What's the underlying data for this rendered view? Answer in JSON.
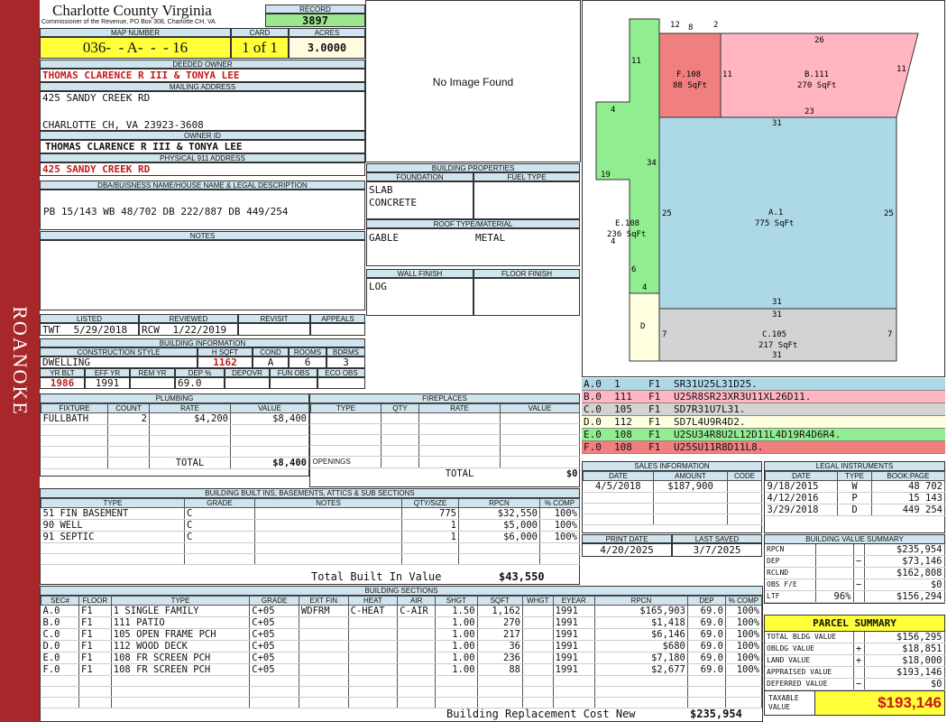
{
  "side_label": "ROANOKE",
  "header": {
    "county": "Charlotte County Virginia",
    "commissioner": "Commissioner of the Revenue, PO Box 308, Charlotte CH, VA",
    "record_label": "RECORD",
    "record": "3897"
  },
  "map": {
    "map_label": "MAP NUMBER",
    "map_number": "036-  - A-  -  - 16",
    "card_label": "CARD",
    "card": "1 of 1",
    "acres_label": "ACRES",
    "acres": "3.0000"
  },
  "owner": {
    "deeded_label": "DEEDED OWNER",
    "deeded": "THOMAS CLARENCE R III & TONYA LEE",
    "mailing_label": "MAILING ADDRESS",
    "mail1": "425 SANDY CREEK RD",
    "mail2": "CHARLOTTE CH, VA 23923-3608",
    "owner_id_label": "OWNER ID",
    "owner_id": "THOMAS CLARENCE R III & TONYA LEE",
    "phys_label": "PHYSICAL 911 ADDRESS",
    "phys": "425 SANDY CREEK RD",
    "dba_label": "DBA/BUISNESS NAME/HOUSE NAME & LEGAL DESCRIPTION",
    "legal": "PB 15/143 WB 48/702 DB 222/887 DB 449/254",
    "notes_label": "NOTES"
  },
  "image_text": "No Image Found",
  "listing": {
    "h": [
      "LISTED",
      "REVIEWED",
      "REVISIT",
      "APPEALS"
    ],
    "listed_by": "TWT",
    "listed": "5/29/2018",
    "reviewed_by": "RCW",
    "reviewed": "1/22/2019"
  },
  "building_info": {
    "title": "BUILDING INFORMATION",
    "h": [
      "CONSTRUCTION STYLE",
      "H SQFT",
      "COND",
      "ROOMS",
      "BDRMS"
    ],
    "style": "DWELLING",
    "hsqft": "1162",
    "cond": "A",
    "rooms": "6",
    "bdrms": "3",
    "h2": [
      "YR BLT",
      "EFF YR",
      "REM YR",
      "DEP %",
      "DEPOVR",
      "FUN OBS",
      "ECO OBS"
    ],
    "yrblt": "1986",
    "effyr": "1991",
    "remyr": "",
    "dep": "69.0"
  },
  "props": {
    "title": "BUILDING PROPERTIES",
    "foundation_label": "FOUNDATION",
    "fuel_label": "FUEL TYPE",
    "foundation1": "SLAB",
    "foundation2": "CONCRETE",
    "roof_label": "ROOF TYPE/MATERIAL",
    "roof1": "GABLE",
    "roof2": "METAL",
    "wall_label": "WALL FINISH",
    "floor_label": "FLOOR FINISH",
    "wall": "LOG"
  },
  "plumbing": {
    "title": "PLUMBING",
    "h": [
      "FIXTURE",
      "COUNT",
      "RATE",
      "VALUE"
    ],
    "rows": [
      [
        "FULLBATH",
        "2",
        "$4,200",
        "$8,400"
      ]
    ],
    "total_label": "TOTAL",
    "total": "$8,400"
  },
  "fireplaces": {
    "title": "FIREPLACES",
    "h": [
      "TYPE",
      "QTY",
      "RATE",
      "VALUE"
    ],
    "openings": "OPENINGS",
    "total_label": "TOTAL",
    "total": "$0"
  },
  "builtins": {
    "title": "BUILDING BUILT INS, BASEMENTS, ATTICS & SUB SECTIONS",
    "h": [
      "TYPE",
      "GRADE",
      "NOTES",
      "QTY/SIZE",
      "RPCN",
      "% COMP"
    ],
    "rows": [
      [
        "51 FIN BASEMENT",
        "C",
        "",
        "775",
        "$32,550",
        "100%"
      ],
      [
        "90 WELL",
        "C",
        "",
        "1",
        "$5,000",
        "100%"
      ],
      [
        "91 SEPTIC",
        "C",
        "",
        "1",
        "$6,000",
        "100%"
      ]
    ],
    "total_label": "Total Built In Value",
    "total": "$43,550"
  },
  "sections": {
    "title": "BUILDING SECTIONS",
    "h": [
      "SEC#",
      "FLOOR",
      "TYPE",
      "GRADE",
      "EXT FIN",
      "HEAT",
      "AIR",
      "SHGT",
      "SQFT",
      "WHGT",
      "EYEAR",
      "RPCN",
      "DEP",
      "% COMP"
    ],
    "rows": [
      [
        "A.0",
        "F1",
        "1 SINGLE FAMILY",
        "C+05",
        "WDFRM",
        "C-HEAT",
        "C-AIR",
        "1.50",
        "1,162",
        "",
        "1991",
        "$165,903",
        "69.0",
        "100%"
      ],
      [
        "B.0",
        "F1",
        "111 PATIO",
        "C+05",
        "",
        "",
        "",
        "1.00",
        "270",
        "",
        "1991",
        "$1,418",
        "69.0",
        "100%"
      ],
      [
        "C.0",
        "F1",
        "105 OPEN FRAME PCH",
        "C+05",
        "",
        "",
        "",
        "1.00",
        "217",
        "",
        "1991",
        "$6,146",
        "69.0",
        "100%"
      ],
      [
        "D.0",
        "F1",
        "112 WOOD DECK",
        "C+05",
        "",
        "",
        "",
        "1.00",
        "36",
        "",
        "1991",
        "$680",
        "69.0",
        "100%"
      ],
      [
        "E.0",
        "F1",
        "108 FR SCREEN PCH",
        "C+05",
        "",
        "",
        "",
        "1.00",
        "236",
        "",
        "1991",
        "$7,180",
        "69.0",
        "100%"
      ],
      [
        "F.0",
        "F1",
        "108 FR SCREEN PCH",
        "C+05",
        "",
        "",
        "",
        "1.00",
        "88",
        "",
        "1991",
        "$2,677",
        "69.0",
        "100%"
      ]
    ],
    "brcn_label": "Building Replacement Cost New",
    "brcn": "$235,954"
  },
  "sketch": {
    "labels": {
      "f": [
        "F.108",
        "88 SqFt"
      ],
      "b": [
        "B.111",
        "270 SqFt"
      ],
      "a": [
        "A.1",
        "775 SqFt"
      ],
      "e": [
        "E.108",
        "236 SqFt"
      ],
      "c": [
        "C.105",
        "217 SqFt"
      ],
      "d": "D"
    },
    "dims": [
      "12",
      "8",
      "2",
      "26",
      "11",
      "11",
      "11",
      "23",
      "31",
      "34",
      "4",
      "19",
      "25",
      "25",
      "4",
      "6",
      "4",
      "31",
      "31",
      "7",
      "7",
      "31"
    ]
  },
  "legend": [
    [
      "A.0",
      "1",
      "F1",
      "SR31U25L31D25.",
      "#add8e6"
    ],
    [
      "B.0",
      "111",
      "F1",
      "U25R8SR23XR3U11XL26D11.",
      "#ffb6c1"
    ],
    [
      "C.0",
      "105",
      "F1",
      "SD7R31U7L31.",
      "#d3d3d3"
    ],
    [
      "D.0",
      "112",
      "F1",
      "SD7L4U9R4D2.",
      "#ffffe0"
    ],
    [
      "E.0",
      "108",
      "F1",
      "U2SU34R8U2L12D11L4D19R4D6R4.",
      "#90ee90"
    ],
    [
      "F.0",
      "108",
      "F1",
      "U25SU11R8D11L8.",
      "#f08080"
    ]
  ],
  "sales": {
    "title": "SALES INFORMATION",
    "h": [
      "DATE",
      "AMOUNT",
      "CODE"
    ],
    "date": "4/5/2018",
    "amount": "$187,900",
    "code": ""
  },
  "legal": {
    "title": "LEGAL INSTRUMENTS",
    "h": [
      "DATE",
      "TYPE",
      "BOOK:PAGE"
    ],
    "rows": [
      [
        "9/18/2015",
        "W",
        "48 702"
      ],
      [
        "4/12/2016",
        "P",
        "15 143"
      ],
      [
        "3/29/2018",
        "D",
        "449 254"
      ]
    ]
  },
  "dates": {
    "print_label": "PRINT DATE",
    "print": "4/20/2025",
    "saved_label": "LAST SAVED",
    "saved": "3/7/2025"
  },
  "bvs": {
    "title": "BUILDING VALUE SUMMARY",
    "rows": [
      [
        "RPCN",
        "",
        "",
        "$235,954"
      ],
      [
        "DEP",
        "",
        "−",
        "$73,146"
      ],
      [
        "RCLND",
        "",
        "",
        "$162,808"
      ],
      [
        "OBS F/E",
        "",
        "−",
        "$0"
      ],
      [
        "LTF",
        "96%",
        "",
        "$156,294"
      ]
    ]
  },
  "parcel": {
    "title": "PARCEL SUMMARY",
    "rows": [
      [
        "TOTAL BLDG VALUE",
        "",
        "$156,295"
      ],
      [
        "OBLDG VALUE",
        "+",
        "$18,851"
      ],
      [
        "LAND VALUE",
        "+",
        "$18,000"
      ],
      [
        "APPRAISED VALUE",
        "",
        "$193,146"
      ],
      [
        "DEFERRED VALUE",
        "−",
        "$0"
      ]
    ],
    "taxable_label1": "TAXABLE",
    "taxable_label2": "VALUE",
    "taxable": "$193,146"
  }
}
